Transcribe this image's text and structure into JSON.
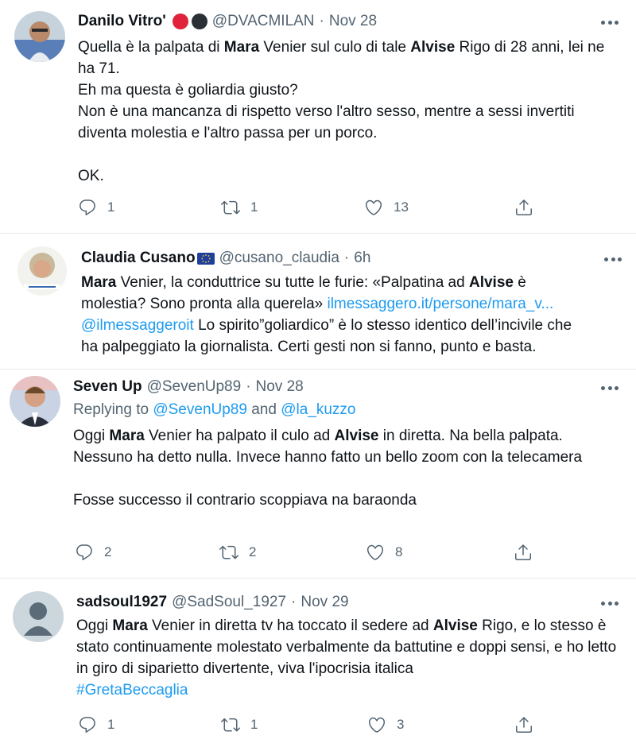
{
  "tweets": [
    {
      "name": "Danilo Vitro'",
      "handle": "@DVACMILAN",
      "sep": "·",
      "time": "Nov 28",
      "badge_colors": [
        "#e0223a",
        "#2b2f36"
      ],
      "text": {
        "l1a": "Quella è la palpata di ",
        "l1b": "Mara",
        "l1c": " Venier sul culo di tale ",
        "l1d": "Alvise",
        "l1e": " Rigo di 28 anni, lei ne ha 71.",
        "l2": "Eh ma questa è goliardia giusto?",
        "l3": "Non è una mancanza di rispetto verso l'altro sesso, mentre a sessi invertiti diventa molestia e l'altro passa per un porco.",
        "l4": "OK."
      },
      "reply_count": "1",
      "retweet_count": "1",
      "like_count": "13"
    },
    {
      "name": "Claudia Cusano",
      "flag": "EU flag",
      "handle": "@cusano_claudia",
      "sep": "·",
      "time": "6h",
      "text": {
        "a": "Mara",
        "b": " Venier, la conduttrice su tutte le furie: «Palpatina ad ",
        "c": "Alvise",
        "d": " è molestia? Sono pronta alla querela» ",
        "link": "ilmessaggero.it/persone/mara_v...",
        "mention": "@ilmessaggeroit",
        "e": " Lo spirito”goliardico” è lo stesso identico dell’incivile che ha palpeggiato la giornalista. Certi gesti non si fanno, punto e basta."
      }
    },
    {
      "name": "Seven Up",
      "handle": "@SevenUp89",
      "sep": "·",
      "time": "Nov 28",
      "replying_prefix": "Replying to ",
      "replying_to_1": "@SevenUp89",
      "replying_and": " and ",
      "replying_to_2": "@la_kuzzo",
      "text": {
        "a": "Oggi ",
        "b": "Mara",
        "c": " Venier ha palpato il culo ad ",
        "d": "Alvise",
        "e": " in diretta. Na bella palpata. Nessuno ha detto nulla. Invece hanno fatto un bello zoom con la telecamera",
        "f": "Fosse successo il contrario scoppiava na baraonda"
      },
      "reply_count": "2",
      "retweet_count": "2",
      "like_count": "8"
    },
    {
      "name": "sadsoul1927",
      "handle": "@SadSoul_1927",
      "sep": "·",
      "time": "Nov 29",
      "text": {
        "a": "Oggi ",
        "b": "Mara",
        "c": " Venier in diretta tv ha toccato il sedere ad ",
        "d": "Alvise",
        "e": " Rigo, e lo stesso è stato continuamente molestato verbalmente da battutine e doppi sensi, e ho letto in giro di siparietto divertente, viva l'ipocrisia italica",
        "hashtag": "#GretaBeccaglia"
      },
      "reply_count": "1",
      "retweet_count": "1",
      "like_count": "3"
    }
  ],
  "icons": [
    "reply-icon",
    "retweet-icon",
    "like-icon",
    "share-icon",
    "more-icon"
  ],
  "colors": {
    "link": "#1d9bf0",
    "muted": "#536471",
    "text": "#0f1419",
    "divider": "#e6e9ec"
  }
}
